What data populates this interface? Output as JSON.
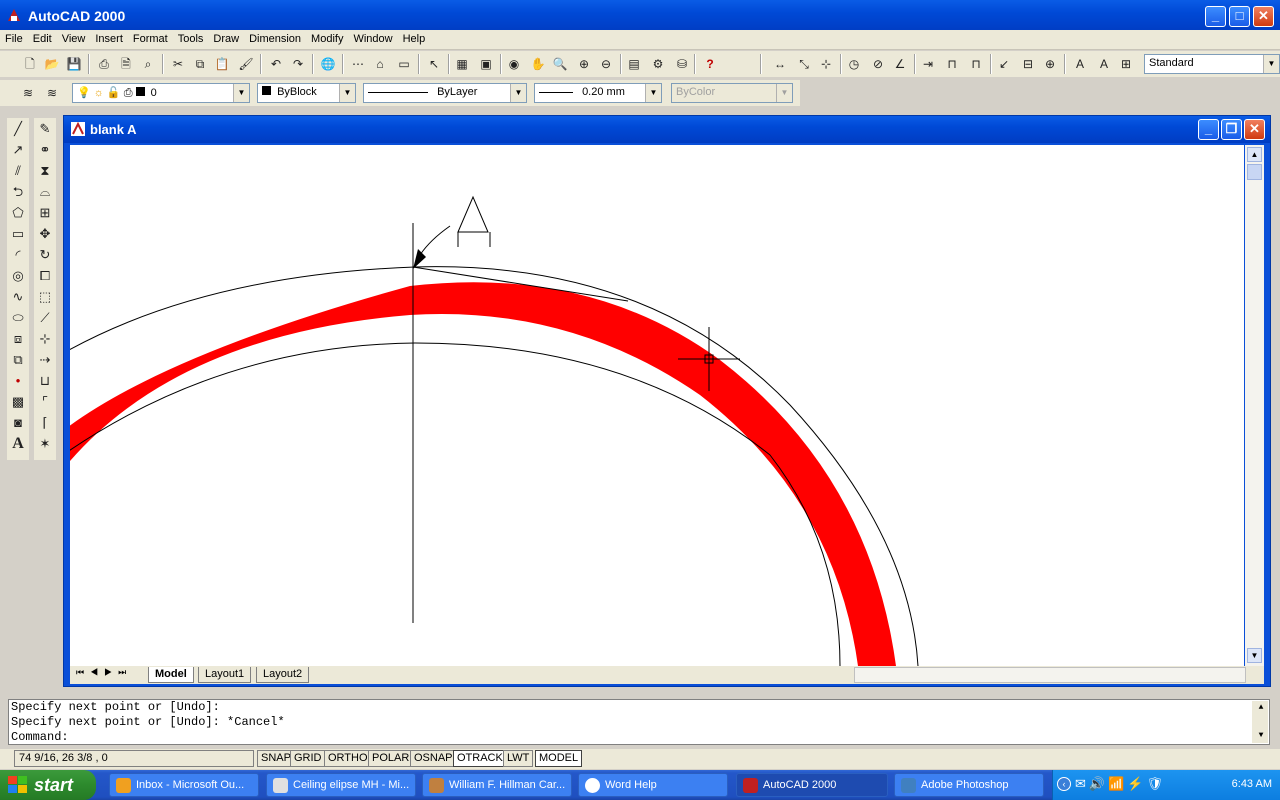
{
  "window": {
    "title": "AutoCAD 2000"
  },
  "menu": [
    "File",
    "Edit",
    "View",
    "Insert",
    "Format",
    "Tools",
    "Draw",
    "Dimension",
    "Modify",
    "Window",
    "Help"
  ],
  "standard_toolbar": {
    "text_style": "Standard"
  },
  "properties_toolbar": {
    "layer": "0",
    "color": "ByBlock",
    "linetype": "ByLayer",
    "lineweight": "0.20 mm",
    "plotstyle": "ByColor"
  },
  "drawing": {
    "title": "blank A",
    "section_mark_label": "A",
    "tabs": [
      "Model",
      "Layout1",
      "Layout2"
    ],
    "active_tab": "Model",
    "band_color": "#ff0000"
  },
  "command_line": [
    "Specify next point or [Undo]:",
    "Specify next point or [Undo]: *Cancel*",
    "Command:"
  ],
  "status": {
    "coords": "74 9/16, 26 3/8 , 0",
    "buttons": [
      "SNAP",
      "GRID",
      "ORTHO",
      "POLAR",
      "OSNAP",
      "OTRACK",
      "LWT",
      "MODEL"
    ]
  },
  "taskbar": {
    "start": "start",
    "tasks": [
      {
        "label": "Inbox - Microsoft Ou..."
      },
      {
        "label": "Ceiling elipse MH - Mi..."
      },
      {
        "label": "William F. Hillman Car..."
      },
      {
        "label": "Word Help"
      },
      {
        "label": "AutoCAD 2000"
      },
      {
        "label": "Adobe Photoshop"
      }
    ],
    "clock": "6:43 AM"
  }
}
